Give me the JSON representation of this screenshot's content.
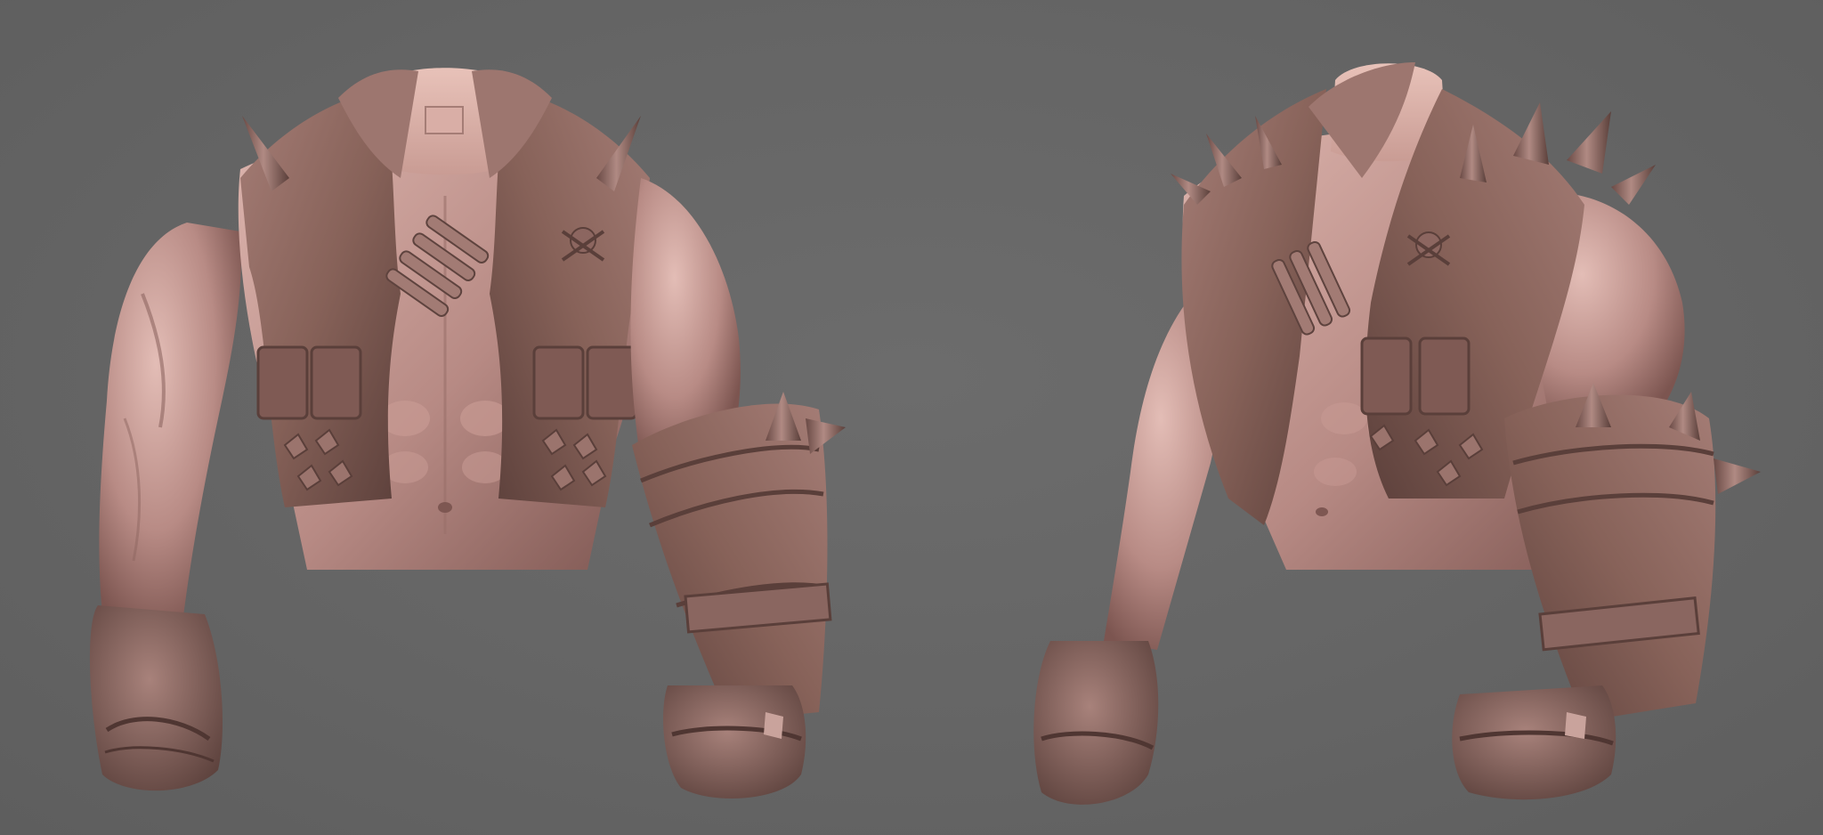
{
  "scene": {
    "background_color": "#666666",
    "clay_skin": "#b88c86",
    "clay_skin_light": "#d9b2ab",
    "clay_skin_dark": "#7e5752",
    "clay_leather": "#8a6660",
    "clay_leather_dark": "#5b403c",
    "clay_leather_light": "#a9827b",
    "models": [
      {
        "view": "front",
        "icon": "sculpt-front-view"
      },
      {
        "view": "three-quarter",
        "icon": "sculpt-three-quarter-view"
      }
    ]
  }
}
